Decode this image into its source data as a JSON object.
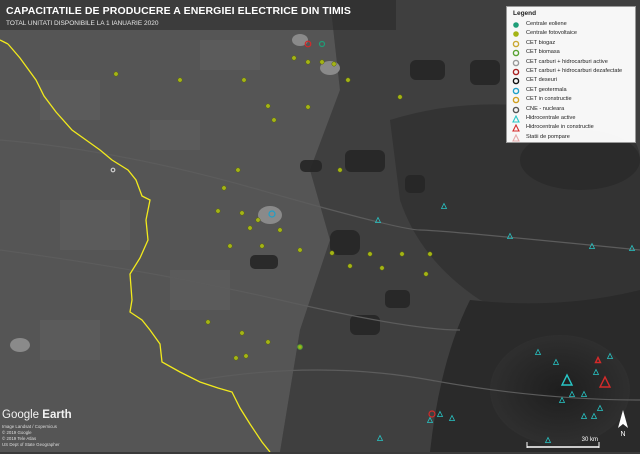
{
  "title": "CAPACITATILE DE PRODUCERE A ENERGIEI ELECTRICE DIN TIMIS",
  "subtitle": "TOTAL UNITATI DISPONIBILE LA 1 IANUARIE 2020",
  "legend": {
    "heading": "Legend",
    "items": [
      {
        "label": "Centrale eoliene",
        "symbol": "dot",
        "color": "#1f9e78"
      },
      {
        "label": "Centrale fotovoltaice",
        "symbol": "dot",
        "color": "#a4b416"
      },
      {
        "label": "CET biogaz",
        "symbol": "ring",
        "color": "#c9a832"
      },
      {
        "label": "CET biomasa",
        "symbol": "ring",
        "color": "#58a332"
      },
      {
        "label": "CET carburi + hidrocarburi active",
        "symbol": "ring",
        "color": "#999999"
      },
      {
        "label": "CET carburi + hidrocarburi dezafectate",
        "symbol": "ring",
        "color": "#aa2222"
      },
      {
        "label": "CET deseuri",
        "symbol": "ring",
        "color": "#111111"
      },
      {
        "label": "CET geotermala",
        "symbol": "ring",
        "color": "#1fa0c8"
      },
      {
        "label": "CET in constructie",
        "symbol": "ring",
        "color": "#d0a020"
      },
      {
        "label": "CNE - nucleara",
        "symbol": "ring",
        "color": "#555555"
      },
      {
        "label": "Hidrocentrale active",
        "symbol": "triangle",
        "color": "#28c6c6"
      },
      {
        "label": "Hidrocentrale in constructie",
        "symbol": "triangle",
        "color": "#d42a2a"
      },
      {
        "label": "Statii de pompare",
        "symbol": "triangle",
        "color": "#e6a8a8"
      }
    ]
  },
  "branding": {
    "logo_part1": "Google",
    "logo_part2": " Earth"
  },
  "credits": [
    "Image Landsat / Copernicus",
    "© 2019 Google",
    "© 2019 Tele Atlas",
    "US Dept of State Geographer"
  ],
  "scale_label": "30 km",
  "north_label": "N",
  "colors": {
    "yellow_border": "#f2ea1c",
    "photovoltaic": "#a4b416",
    "hydro_active": "#28c6c6",
    "hydro_construction": "#d42a2a"
  }
}
